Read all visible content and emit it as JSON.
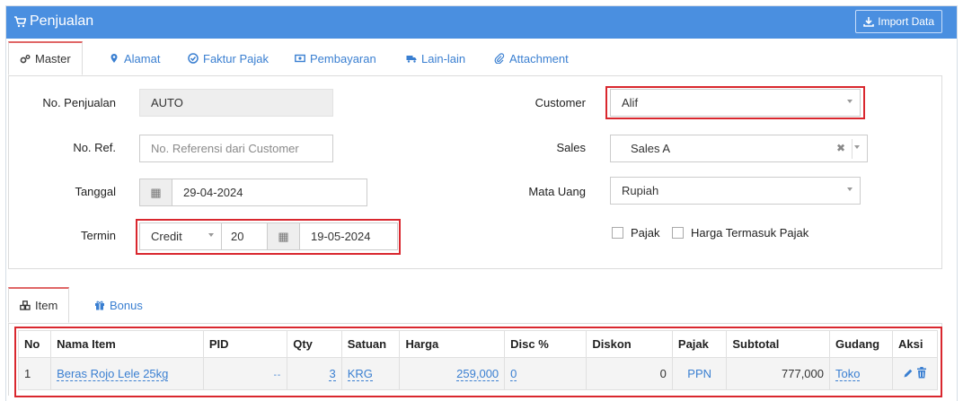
{
  "header": {
    "title": "Penjualan",
    "import_label": "Import Data"
  },
  "tabs": [
    {
      "label": "Master",
      "icon": "cogs-icon"
    },
    {
      "label": "Alamat",
      "icon": "map-marker-icon"
    },
    {
      "label": "Faktur Pajak",
      "icon": "check-circle-icon"
    },
    {
      "label": "Pembayaran",
      "icon": "money-icon"
    },
    {
      "label": "Lain-lain",
      "icon": "truck-icon"
    },
    {
      "label": "Attachment",
      "icon": "paperclip-icon"
    }
  ],
  "form": {
    "no_penjualan": {
      "label": "No. Penjualan",
      "value": "AUTO"
    },
    "no_ref": {
      "label": "No. Ref.",
      "placeholder": "No. Referensi dari Customer"
    },
    "tanggal": {
      "label": "Tanggal",
      "value": "29-04-2024"
    },
    "termin": {
      "label": "Termin",
      "type": "Credit",
      "days": "20",
      "due": "19-05-2024"
    },
    "customer": {
      "label": "Customer",
      "value": "Alif"
    },
    "sales": {
      "label": "Sales",
      "value": "Sales A"
    },
    "mata_uang": {
      "label": "Mata Uang",
      "value": "Rupiah"
    },
    "pajak_label": "Pajak",
    "harga_termasuk_pajak_label": "Harga Termasuk Pajak"
  },
  "item_tabs": [
    {
      "label": "Item",
      "icon": "cubes-icon"
    },
    {
      "label": "Bonus",
      "icon": "gift-icon"
    }
  ],
  "table": {
    "columns": [
      "No",
      "Nama Item",
      "PID",
      "Qty",
      "Satuan",
      "Harga",
      "Disc %",
      "Diskon",
      "Pajak",
      "Subtotal",
      "Gudang",
      "Aksi"
    ],
    "rows": [
      {
        "no": "1",
        "nama": "Beras Rojo Lele 25kg",
        "pid": "",
        "qty": "3",
        "satuan": "KRG",
        "harga": "259,000",
        "disc": "0",
        "diskon": "0",
        "pajak": "PPN",
        "subtotal": "777,000",
        "gudang": "Toko"
      }
    ]
  },
  "colors": {
    "header_bg": "#4a8fe0",
    "link": "#3a7fd1",
    "highlight": "#d9272e"
  }
}
